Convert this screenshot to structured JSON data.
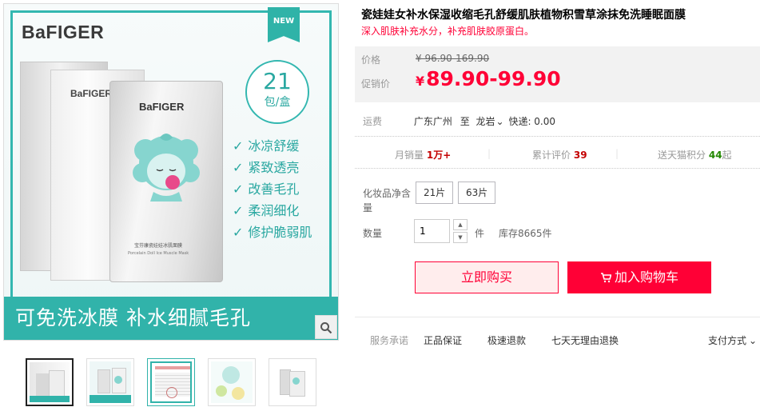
{
  "product": {
    "title": "瓷娃娃女补水保湿收缩毛孔舒缓肌肤植物积雪草涂抹免洗睡眠面膜",
    "subtitle": "深入肌肤补充水分，补充肌肤胶原蛋白。"
  },
  "gallery": {
    "brand": "BaFIGER",
    "new_tag": "NEW",
    "count_number": "21",
    "count_unit": "包/盒",
    "features": [
      "冰凉舒缓",
      "紧致透亮",
      "改善毛孔",
      "柔润细化",
      "修护脆弱肌"
    ],
    "banner": "可免洗冰膜 补水细腻毛孔",
    "sachet_caption_cn": "宝芬康瓷娃娃冰肌面膜",
    "sachet_caption_en": "Porcelain Doll Ice Muscle Mask",
    "zoom_icon": "search-icon",
    "thumbnail_count": 5
  },
  "price": {
    "label": "价格",
    "original": "¥ 96.90-169.90",
    "promo_label": "促销价",
    "currency": "¥",
    "promo": "89.90-99.90"
  },
  "shipping": {
    "label": "运费",
    "from": "广东广州",
    "to_word": "至",
    "dest": "龙岩",
    "express": "快递: 0.00"
  },
  "stats": {
    "monthly_label": "月销量",
    "monthly_value": "1万+",
    "reviews_label": "累计评价",
    "reviews_value": "39",
    "points_label": "送天猫积分",
    "points_value": "44",
    "points_suffix": "起"
  },
  "spec": {
    "label": "化妆品净含量",
    "options": [
      "21片",
      "63片"
    ]
  },
  "quantity": {
    "label": "数量",
    "value": "1",
    "unit": "件",
    "stock": "库存8665件"
  },
  "actions": {
    "buy_now": "立即购买",
    "add_cart": "加入购物车"
  },
  "services": {
    "label": "服务承诺",
    "items": [
      "正品保证",
      "极速退款",
      "七天无理由退换"
    ],
    "payment": "支付方式"
  },
  "colors": {
    "accent": "#ff0036",
    "teal": "#33b7b0"
  }
}
